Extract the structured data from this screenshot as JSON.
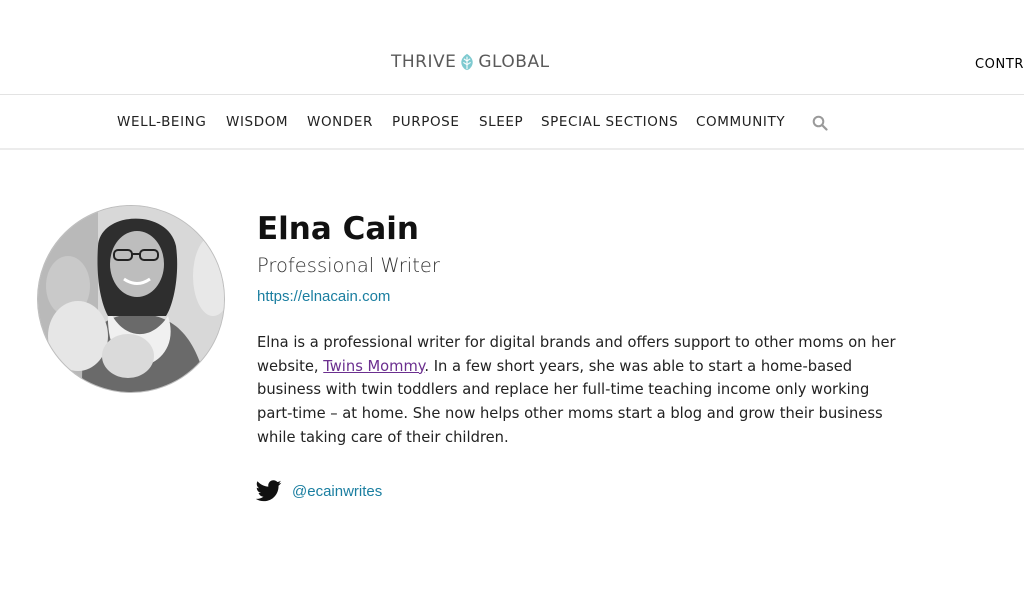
{
  "header": {
    "logo_left": "THRIVE",
    "logo_right": "GLOBAL",
    "contribute_label": "CONTR"
  },
  "nav": {
    "items": [
      {
        "label": "WELL-BEING"
      },
      {
        "label": "WISDOM"
      },
      {
        "label": "WONDER"
      },
      {
        "label": "PURPOSE"
      },
      {
        "label": "SLEEP"
      },
      {
        "label": "SPECIAL SECTIONS"
      },
      {
        "label": "COMMUNITY"
      }
    ],
    "search_icon": "search-icon"
  },
  "profile": {
    "name": "Elna Cain",
    "title": "Professional Writer",
    "website": "https://elnacain.com",
    "bio_before_link": "Elna is a professional writer for digital brands and offers support to other moms on her website, ",
    "bio_link": "Twins Mommy",
    "bio_after_link": ". In a few short years, she was able to start a home-based business with twin toddlers and replace her full-time teaching income only working part-time – at home. She now helps other moms start a blog and grow their business while taking care of their children.",
    "twitter_icon": "twitter-bird-icon",
    "twitter_handle": "@ecainwrites"
  },
  "colors": {
    "link": "#1a7ea0",
    "visited_link": "#6b2f8f",
    "logo_leaf": "#7ecad0"
  }
}
